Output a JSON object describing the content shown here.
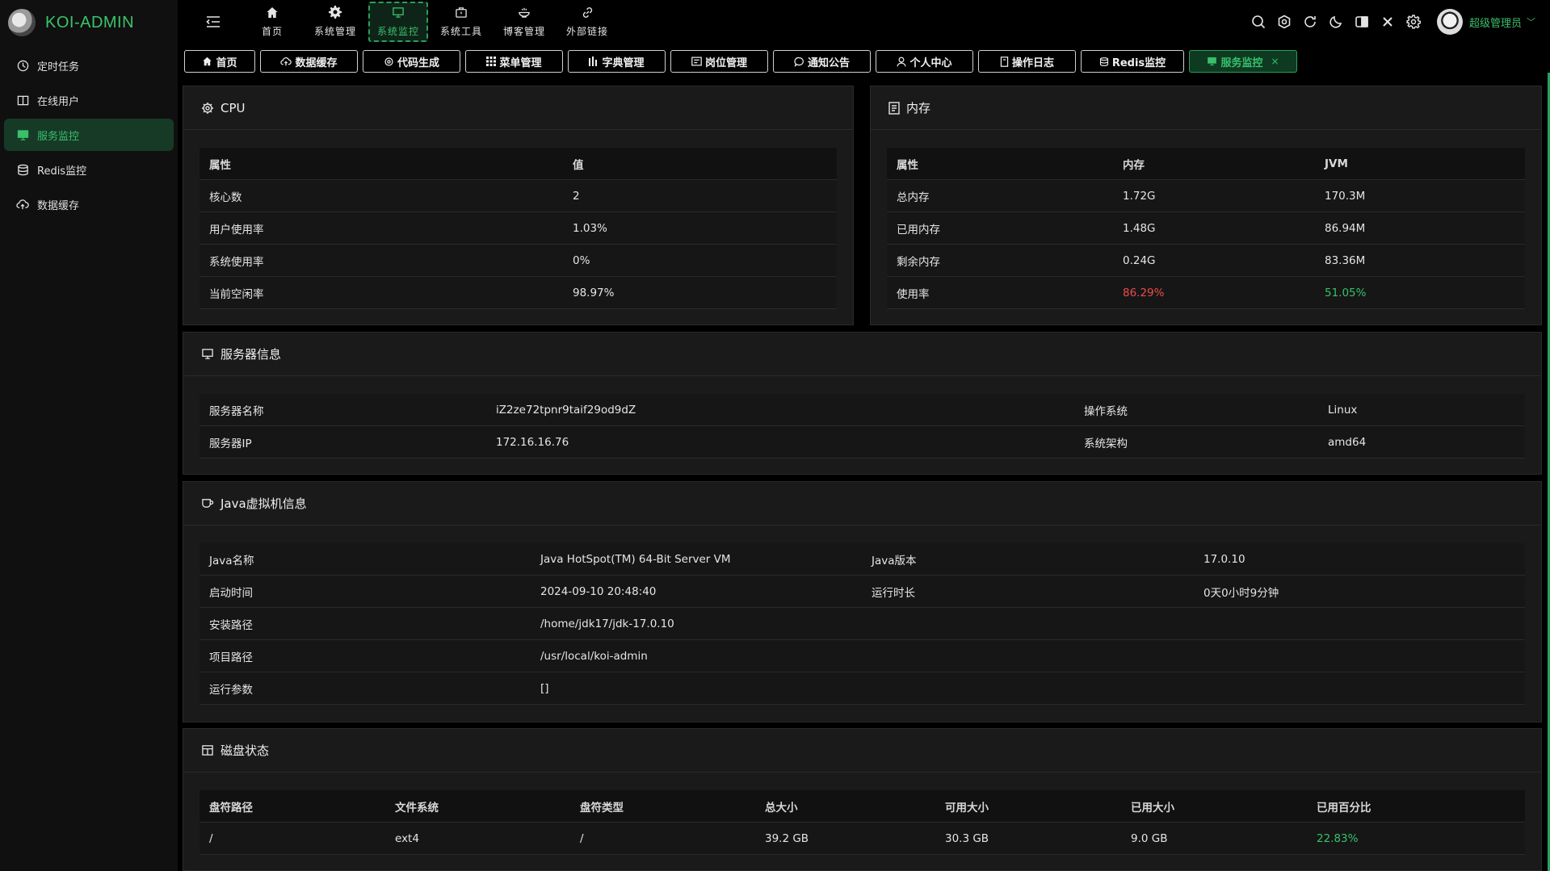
{
  "app": {
    "title": "KOI-ADMIN"
  },
  "sidebar": {
    "items": [
      {
        "label": "定时任务",
        "icon": "clock-icon"
      },
      {
        "label": "在线用户",
        "icon": "book-icon"
      },
      {
        "label": "服务监控",
        "icon": "monitor-icon",
        "active": true
      },
      {
        "label": "Redis监控",
        "icon": "database-icon"
      },
      {
        "label": "数据缓存",
        "icon": "cloud-upload-icon"
      }
    ]
  },
  "header": {
    "nav": [
      {
        "label": "首页",
        "icon": "home-icon"
      },
      {
        "label": "系统管理",
        "icon": "gear-icon"
      },
      {
        "label": "系统监控",
        "icon": "monitor-icon",
        "active": true
      },
      {
        "label": "系统工具",
        "icon": "toolbox-icon"
      },
      {
        "label": "博客管理",
        "icon": "bowl-icon"
      },
      {
        "label": "外部链接",
        "icon": "link-icon"
      }
    ],
    "user_name": "超级管理员",
    "user_caret": "﹀"
  },
  "tabs": [
    {
      "label": "首页",
      "icon": "home-icon"
    },
    {
      "label": "数据缓存",
      "icon": "cloud-upload-icon"
    },
    {
      "label": "代码生成",
      "icon": "gear-icon"
    },
    {
      "label": "菜单管理",
      "icon": "grid-icon"
    },
    {
      "label": "字典管理",
      "icon": "bars-icon"
    },
    {
      "label": "岗位管理",
      "icon": "id-card-icon"
    },
    {
      "label": "通知公告",
      "icon": "chat-icon"
    },
    {
      "label": "个人中心",
      "icon": "user-icon"
    },
    {
      "label": "操作日志",
      "icon": "doc-icon"
    },
    {
      "label": "Redis监控",
      "icon": "database-icon"
    },
    {
      "label": "服务监控",
      "icon": "monitor-icon",
      "active": true,
      "close": "×"
    }
  ],
  "cpu": {
    "title": "CPU",
    "headers": [
      "属性",
      "值"
    ],
    "rows": [
      [
        "核心数",
        "2"
      ],
      [
        "用户使用率",
        "1.03%"
      ],
      [
        "系统使用率",
        "0%"
      ],
      [
        "当前空闲率",
        "98.97%"
      ]
    ]
  },
  "memory": {
    "title": "内存",
    "headers": [
      "属性",
      "内存",
      "JVM"
    ],
    "rows": [
      [
        "总内存",
        "1.72G",
        "170.3M"
      ],
      [
        "已用内存",
        "1.48G",
        "86.94M"
      ],
      [
        "剩余内存",
        "0.24G",
        "83.36M"
      ],
      [
        "使用率",
        "86.29%",
        "51.05%"
      ]
    ]
  },
  "server": {
    "title": "服务器信息",
    "rows": [
      [
        "服务器名称",
        "iZ2ze72tpnr9taif29od9dZ",
        "操作系统",
        "Linux"
      ],
      [
        "服务器IP",
        "172.16.16.76",
        "系统架构",
        "amd64"
      ]
    ]
  },
  "jvm": {
    "title": "Java虚拟机信息",
    "rows": [
      [
        "Java名称",
        "Java HotSpot(TM) 64-Bit Server VM",
        "Java版本",
        "17.0.10"
      ],
      [
        "启动时间",
        "2024-09-10 20:48:40",
        "运行时长",
        "0天0小时9分钟"
      ],
      [
        "安装路径",
        "/home/jdk17/jdk-17.0.10",
        "",
        ""
      ],
      [
        "项目路径",
        "/usr/local/koi-admin",
        "",
        ""
      ],
      [
        "运行参数",
        "[]",
        "",
        ""
      ]
    ]
  },
  "disk": {
    "title": "磁盘状态",
    "headers": [
      "盘符路径",
      "文件系统",
      "盘符类型",
      "总大小",
      "可用大小",
      "已用大小",
      "已用百分比"
    ],
    "rows": [
      [
        "/",
        "ext4",
        "/",
        "39.2 GB",
        "30.3 GB",
        "9.0 GB",
        "22.83%"
      ]
    ]
  },
  "colors": {
    "accent": "#38c06a",
    "danger": "#f04b4b",
    "card_bg": "#1a1a1a",
    "sidebar_bg": "#101010"
  }
}
